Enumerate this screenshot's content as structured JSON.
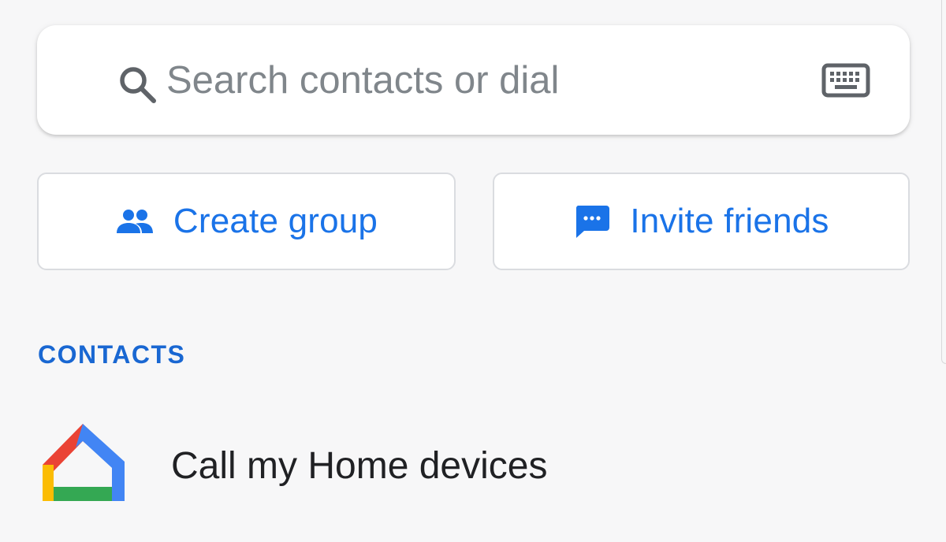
{
  "search": {
    "placeholder": "Search contacts or dial",
    "value": ""
  },
  "actions": {
    "create_group_label": "Create group",
    "invite_friends_label": "Invite friends"
  },
  "contacts": {
    "section_label": "CONTACTS",
    "items": [
      {
        "name": "Call my Home devices",
        "icon": "google-home-icon"
      }
    ]
  },
  "icons": {
    "search": "search-icon",
    "keyboard": "keyboard-icon",
    "group": "group-icon",
    "message": "message-icon"
  },
  "colors": {
    "accent": "#1a73e8",
    "section_header": "#1967d2",
    "text_primary": "#202124",
    "placeholder": "#80868b",
    "background": "#f7f7f8"
  }
}
